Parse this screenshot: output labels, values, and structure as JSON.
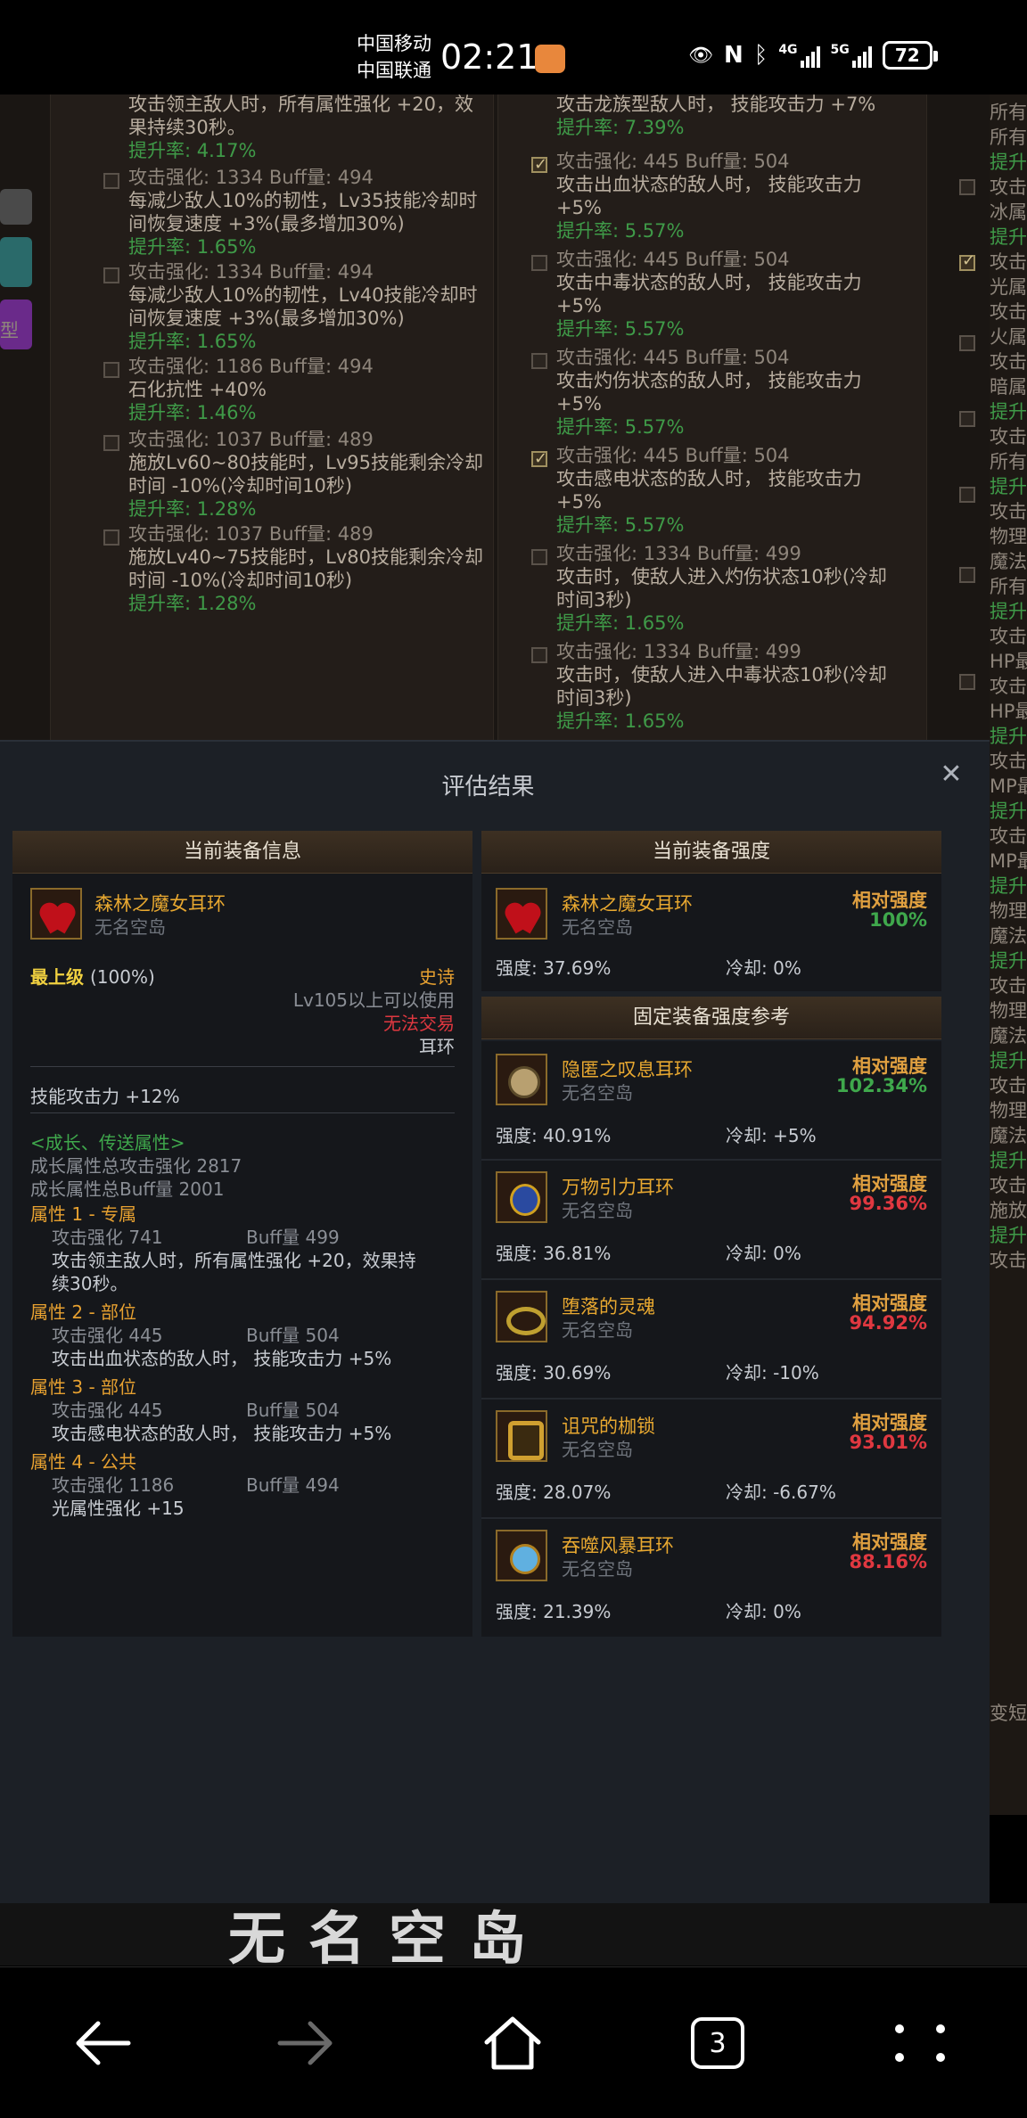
{
  "status_bar": {
    "carrier1": "中国移动",
    "carrier2": "中国联通",
    "time": "02:21",
    "network": "4G",
    "network2": "5G",
    "battery": "72"
  },
  "background": {
    "left_col": [
      {
        "top": "攻击领主敌人时，所有属性强化 +20，效",
        "top2": "果持续30秒。",
        "rate": "提升率: 4.17%"
      },
      {
        "stats": "攻击强化: 1334      Buff量: 494",
        "desc": "每减少敌人10%的韧性，Lv35技能冷却时",
        "desc2": "间恢复速度 +3%(最多增加30%)",
        "rate": "提升率: 1.65%"
      },
      {
        "stats": "攻击强化: 1334      Buff量: 494",
        "desc": "每减少敌人10%的韧性，Lv40技能冷却时",
        "desc2": "间恢复速度 +3%(最多增加30%)",
        "rate": "提升率: 1.65%"
      },
      {
        "stats": "攻击强化: 1186      Buff量: 494",
        "desc": "石化抗性 +40%",
        "rate": "提升率: 1.46%"
      },
      {
        "stats": "攻击强化: 1037      Buff量: 489",
        "desc": "施放Lv60~80技能时，Lv95技能剩余冷却",
        "desc2": "时间 -10%(冷却时间10秒)",
        "rate": "提升率: 1.28%"
      },
      {
        "stats": "攻击强化: 1037      Buff量: 489",
        "desc": "施放Lv40~75技能时，Lv80技能剩余冷却",
        "desc2": "时间 -10%(冷却时间10秒)",
        "rate": "提升率: 1.28%"
      }
    ],
    "left_tag": "型",
    "mid_col": [
      {
        "top": "攻击龙族型敌人时， 技能攻击力 +7%",
        "rate": "提升率: 7.39%"
      },
      {
        "stats": "攻击强化: 445       Buff量: 504",
        "desc": "攻击出血状态的敌人时， 技能攻击力",
        "desc2": "+5%",
        "rate": "提升率: 5.57%"
      },
      {
        "stats": "攻击强化: 445       Buff量: 504",
        "desc": "攻击中毒状态的敌人时， 技能攻击力",
        "desc2": "+5%",
        "rate": "提升率: 5.57%"
      },
      {
        "stats": "攻击强化: 445       Buff量: 504",
        "desc": "攻击灼伤状态的敌人时， 技能攻击力",
        "desc2": "+5%",
        "rate": "提升率: 5.57%"
      },
      {
        "stats": "攻击强化: 445       Buff量: 504",
        "desc": "攻击感电状态的敌人时， 技能攻击力",
        "desc2": "+5%",
        "rate": "提升率: 5.57%"
      },
      {
        "stats": "攻击强化: 1334      Buff量: 499",
        "desc": "攻击时，使敌人进入灼伤状态10秒(冷却",
        "desc2": "时间3秒)",
        "rate": "提升率: 1.65%"
      },
      {
        "stats": "攻击强化: 1334      Buff量: 499",
        "desc": "攻击时，使敌人进入中毒状态10秒(冷却",
        "desc2": "时间3秒)",
        "rate": "提升率: 1.65%"
      }
    ],
    "right_strip": [
      "所有",
      "所有",
      "提升",
      "攻击",
      "冰属",
      "提升",
      "攻击",
      "光属",
      "攻击",
      "火属",
      "攻击",
      "暗属",
      "提升",
      "攻击",
      "所有",
      "提升",
      "攻击",
      "物理",
      "魔法",
      "所有",
      "提升",
      "攻击",
      "HP最",
      "攻击",
      "HP最",
      "提升",
      "攻击",
      "MP最",
      "提升",
      "攻击",
      "MP最",
      "提升",
      "物理",
      "魔法",
      "提升",
      "攻击",
      "物理",
      "魔法",
      "提升",
      "攻击",
      "物理",
      "魔法",
      "提升",
      "攻击",
      "施放",
      "提升",
      "攻击"
    ],
    "right_strip2": [
      "变短"
    ]
  },
  "modal": {
    "title": "评估结果",
    "left_panel": {
      "header": "当前装备信息",
      "item_name": "森林之魔女耳环",
      "item_source": "无名空岛",
      "grade": "最上级",
      "grade_pct": "(100%)",
      "rarity": "史诗",
      "level_req": "Lv105以上可以使用",
      "trade": "无法交易",
      "slot": "耳环",
      "skill_atk": "技能攻击力  +12%",
      "growth_title": "<成长、传送属性>",
      "growth_atk": "成长属性总攻击强化 2817",
      "growth_buff": "成长属性总Buff量 2001",
      "attributes": [
        {
          "name": "属性 1 - 专属",
          "atk": "攻击强化  741",
          "buff": "Buff量  499",
          "desc": "攻击领主敌人时，所有属性强化 +20，效果持",
          "desc2": "续30秒。"
        },
        {
          "name": "属性 2 - 部位",
          "atk": "攻击强化  445",
          "buff": "Buff量  504",
          "desc": "攻击出血状态的敌人时， 技能攻击力 +5%"
        },
        {
          "name": "属性 3 - 部位",
          "atk": "攻击强化  445",
          "buff": "Buff量  504",
          "desc": "攻击感电状态的敌人时， 技能攻击力 +5%"
        },
        {
          "name": "属性 4 - 公共",
          "atk": "攻击强化  1186",
          "buff": "Buff量  494",
          "desc": "光属性强化 +15"
        }
      ]
    },
    "right_panel": {
      "header": "当前装备强度",
      "rel_label": "相对强度",
      "current": {
        "name": "森林之魔女耳环",
        "source": "无名空岛",
        "rel": "100%",
        "strength": "强度: 37.69%",
        "cooldown": "冷却: 0%"
      },
      "ref_header": "固定装备强度参考",
      "refs": [
        {
          "name": "隐匿之叹息耳环",
          "source": "无名空岛",
          "rel": "102.34%",
          "strength": "强度: 40.91%",
          "cooldown": "冷却: +5%"
        },
        {
          "name": "万物引力耳环",
          "source": "无名空岛",
          "rel": "99.36%",
          "strength": "强度: 36.81%",
          "cooldown": "冷却: 0%"
        },
        {
          "name": "堕落的灵魂",
          "source": "无名空岛",
          "rel": "94.92%",
          "strength": "强度: 30.69%",
          "cooldown": "冷却: -10%"
        },
        {
          "name": "诅咒的枷锁",
          "source": "无名空岛",
          "rel": "93.01%",
          "strength": "强度: 28.07%",
          "cooldown": "冷却: -6.67%"
        },
        {
          "name": "吞噬风暴耳环",
          "source": "无名空岛",
          "rel": "88.16%",
          "strength": "强度: 21.39%",
          "cooldown": "冷却: 0%"
        }
      ]
    }
  },
  "watermark": "无名空岛",
  "nav": {
    "tab_count": "3"
  },
  "colors": {
    "positive": "#3fa84c",
    "negative": "#e03840",
    "item_name": "#e8a830",
    "header_bg": "#3d3022"
  }
}
